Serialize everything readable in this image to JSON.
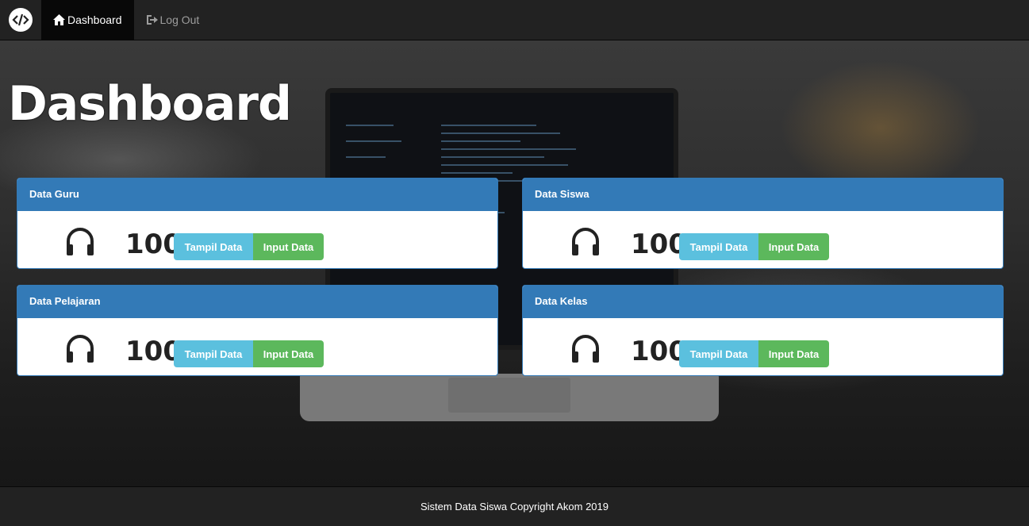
{
  "navbar": {
    "brand_icon": "code-icon",
    "items": [
      {
        "label": "Dashboard",
        "icon": "home-icon",
        "active": true
      },
      {
        "label": "Log Out",
        "icon": "logout-icon",
        "active": false
      }
    ]
  },
  "page": {
    "title": "Dashboard"
  },
  "panels": [
    {
      "title": "Data Guru",
      "count": "100",
      "icon": "headphones-icon",
      "btn_view": "Tampil Data",
      "btn_input": "Input Data"
    },
    {
      "title": "Data Siswa",
      "count": "100",
      "icon": "headphones-icon",
      "btn_view": "Tampil Data",
      "btn_input": "Input Data"
    },
    {
      "title": "Data Pelajaran",
      "count": "100",
      "icon": "headphones-icon",
      "btn_view": "Tampil Data",
      "btn_input": "Input Data"
    },
    {
      "title": "Data Kelas",
      "count": "100",
      "icon": "headphones-icon",
      "btn_view": "Tampil Data",
      "btn_input": "Input Data"
    }
  ],
  "footer": {
    "text": "Sistem Data Siswa Copyright Akom 2019"
  },
  "colors": {
    "primary": "#337ab7",
    "info": "#5bc0de",
    "success": "#5cb85c",
    "navbar": "#222222"
  }
}
